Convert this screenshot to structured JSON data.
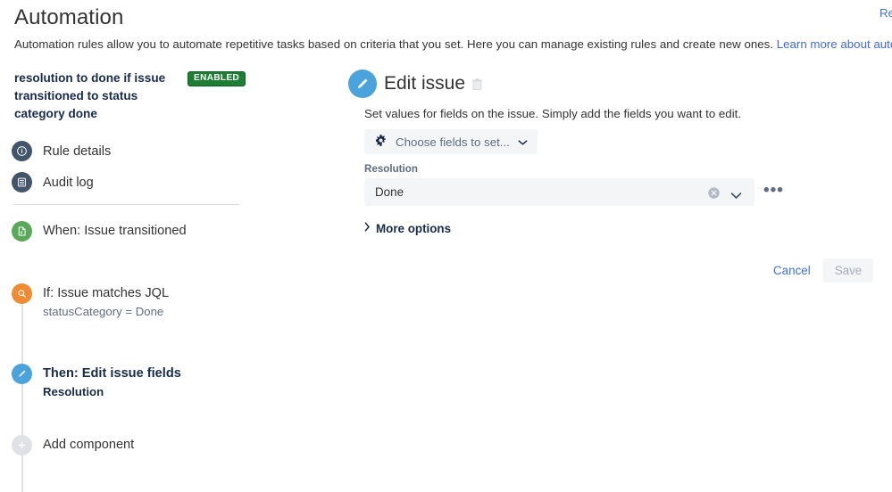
{
  "header": {
    "title": "Automation",
    "subtitle_text": "Automation rules allow you to automate repetitive tasks based on criteria that you set. Here you can manage existing rules and create new ones.",
    "learn_more_label": "Learn more about automation",
    "top_right_label": "Re"
  },
  "rule": {
    "name": "resolution to done if issue transitioned to status category done",
    "status_badge": "ENABLED",
    "nav": [
      {
        "label": "Rule details",
        "icon": "info-circle-icon"
      },
      {
        "label": "Audit log",
        "icon": "list-document-icon"
      }
    ],
    "steps": [
      {
        "title": "When: Issue transitioned",
        "subtitle": "",
        "icon": "trigger-document-icon",
        "color": "#5aa95a",
        "bold": false
      },
      {
        "title": "If: Issue matches JQL",
        "subtitle": "statusCategory = Done",
        "icon": "magnifier-icon",
        "color": "#f08a33",
        "bold": false
      },
      {
        "title": "Then: Edit issue fields",
        "subtitle": "Resolution",
        "icon": "pencil-icon",
        "color": "#4ba3db",
        "bold": true
      },
      {
        "title": "Add component",
        "subtitle": "",
        "icon": "plus-icon",
        "color": "#dfe1e6",
        "bold": false
      }
    ]
  },
  "panel": {
    "icon": "pencil-icon",
    "title": "Edit issue",
    "delete_icon": "trash-icon",
    "description": "Set values for fields on the issue. Simply add the fields you want to edit.",
    "choose_fields_label": "Choose fields to set...",
    "choose_fields_icon": "gear-icon",
    "fields": [
      {
        "label": "Resolution",
        "value": "Done",
        "clear_icon": "clear-circle-icon",
        "chevron_icon": "chevron-down-icon",
        "more_icon": "ellipsis-icon",
        "more_label": "•••"
      }
    ],
    "more_options_label": "More options",
    "more_options_icon": "chevron-right-icon",
    "cancel_label": "Cancel",
    "save_label": "Save"
  },
  "colors": {
    "accent_blue": "#4ba3db",
    "link_blue": "#3b73d8",
    "enabled_green": "#1e7e34",
    "trigger_green": "#5aa95a",
    "condition_orange": "#f08a33",
    "nav_icon_slate": "#44546a",
    "field_bg": "#f4f5f7"
  }
}
